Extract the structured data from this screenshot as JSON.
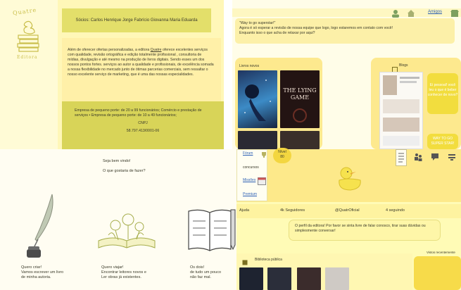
{
  "panel_company": {
    "logo_text_top": "Quatre",
    "logo_text_bottom": "Editora",
    "partners": "Sócios: Carlos Henrique Jorge Fabrício Giovanna Maria Eduarda",
    "desc_1": "Além de oferecer ofertas personalizadas, a editora ",
    "desc_link": "Quatre",
    "desc_2": " oferece excelentes serviços com qualidade, revisão ortográfica e edição totalmente profissional , consultoria de mídias, divulgação e até mesmo na produção de livros digitais. Sendo esses um dos nossos pontos fortes. serviços ao autor a qualidade e profissionais, de excelência somada a nossa flexibilidade no mercado junto de ótimas parcerias comerciais, sem ressaltar o nosso excelente serviço de marketing, que é uma das nossas especialidades.",
    "company_type": "Empresa de pequeno porte: de 20 a 99 funcionários; Comércio e prestação de serviços • Empresa de pequeno porte: de 10 a 49 funcionários;",
    "cnpj_label": "CNPJ",
    "cnpj": "58.797.413/0001-06"
  },
  "panel_chat": {
    "nav_link": "Amigos",
    "message_line1": "\"Way to go superstar!\"",
    "message_line2": "Agora é só esperar a revisão de nossa equipe que logo, logo estaremos em contato com você!",
    "message_line3": "Enquanto isso o que acha de relaxar por aqui?",
    "livros_label": "Livros novos",
    "book_title": "THE LYING GAME",
    "blogs_label": "Blogs",
    "side_card_1": "Ei pessoal! você leu o que é beber conhecer de novo?",
    "side_card_2": "WAY TO GO SUPER STAR!"
  },
  "panel_home": {
    "welcome": "Seja bem vindo!",
    "question": "O que gostaria de fazer?",
    "option_1_line1": "Quero criar!",
    "option_1_line2": "Vamos escrever um livro",
    "option_1_line3": "de minha autoria.",
    "option_2_line1": "Quero viajar!",
    "option_2_line2": "Encontrar leitores novos e",
    "option_2_line3": "Ler obras já existentes.",
    "option_3_line1": "Os dois!",
    "option_3_line2": "de tudo um pouco",
    "option_3_line3": "não faz mal."
  },
  "panel_profile": {
    "menu": [
      "Fórum",
      "concursos",
      "Missões",
      "Premium"
    ],
    "level_label": "Nível",
    "level_value": "80",
    "stats": [
      "Ajuda",
      "4k Seguidores",
      "@QuatrOficial",
      "4 seguindo"
    ],
    "message": "O perfil da editora! Por favor se sinta livre de falar conosco, tirar suas dúvidas ou simplesmente conversar!",
    "library_label": "Biblioteca pública",
    "recent_label": "Vistos recentemente"
  },
  "colors": {
    "yellow_dark": "#d8d458",
    "yellow_soft": "#fff7b8",
    "link_blue": "#2b5fb4"
  }
}
